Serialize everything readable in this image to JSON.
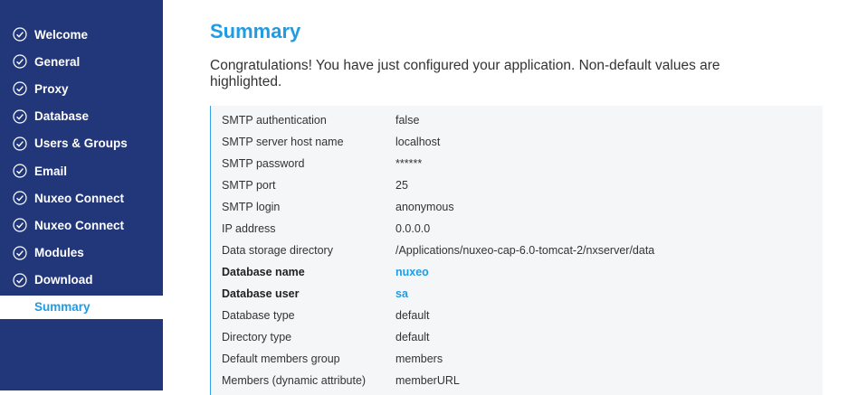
{
  "sidebar": {
    "items": [
      {
        "label": "Welcome",
        "done": true
      },
      {
        "label": "General",
        "done": true
      },
      {
        "label": "Proxy",
        "done": true
      },
      {
        "label": "Database",
        "done": true
      },
      {
        "label": "Users & Groups",
        "done": true
      },
      {
        "label": "Email",
        "done": true
      },
      {
        "label": "Nuxeo Connect",
        "done": true
      },
      {
        "label": "Nuxeo Connect",
        "done": true
      },
      {
        "label": "Modules",
        "done": true
      },
      {
        "label": "Download",
        "done": true
      }
    ],
    "active": {
      "label": "Summary"
    }
  },
  "main": {
    "title": "Summary",
    "intro": "Congratulations! You have just configured your application. Non-default values are highlighted.",
    "rows": [
      {
        "key": "SMTP authentication",
        "value": "false",
        "highlight": false
      },
      {
        "key": "SMTP server host name",
        "value": "localhost",
        "highlight": false
      },
      {
        "key": "SMTP password",
        "value": "******",
        "highlight": false
      },
      {
        "key": "SMTP port",
        "value": "25",
        "highlight": false
      },
      {
        "key": "SMTP login",
        "value": "anonymous",
        "highlight": false
      },
      {
        "key": "IP address",
        "value": "0.0.0.0",
        "highlight": false
      },
      {
        "key": "Data storage directory",
        "value": "/Applications/nuxeo-cap-6.0-tomcat-2/nxserver/data",
        "highlight": false
      },
      {
        "key": "Database name",
        "value": "nuxeo",
        "highlight": true
      },
      {
        "key": "Database user",
        "value": "sa",
        "highlight": true
      },
      {
        "key": "Database type",
        "value": "default",
        "highlight": false
      },
      {
        "key": "Directory type",
        "value": "default",
        "highlight": false
      },
      {
        "key": "Default members group",
        "value": "members",
        "highlight": false
      },
      {
        "key": "Members (dynamic attribute)",
        "value": "memberURL",
        "highlight": false
      }
    ]
  },
  "colors": {
    "sidebar": "#22367a",
    "accent": "#1f9ce3",
    "table_bg": "#f5f6f8"
  }
}
